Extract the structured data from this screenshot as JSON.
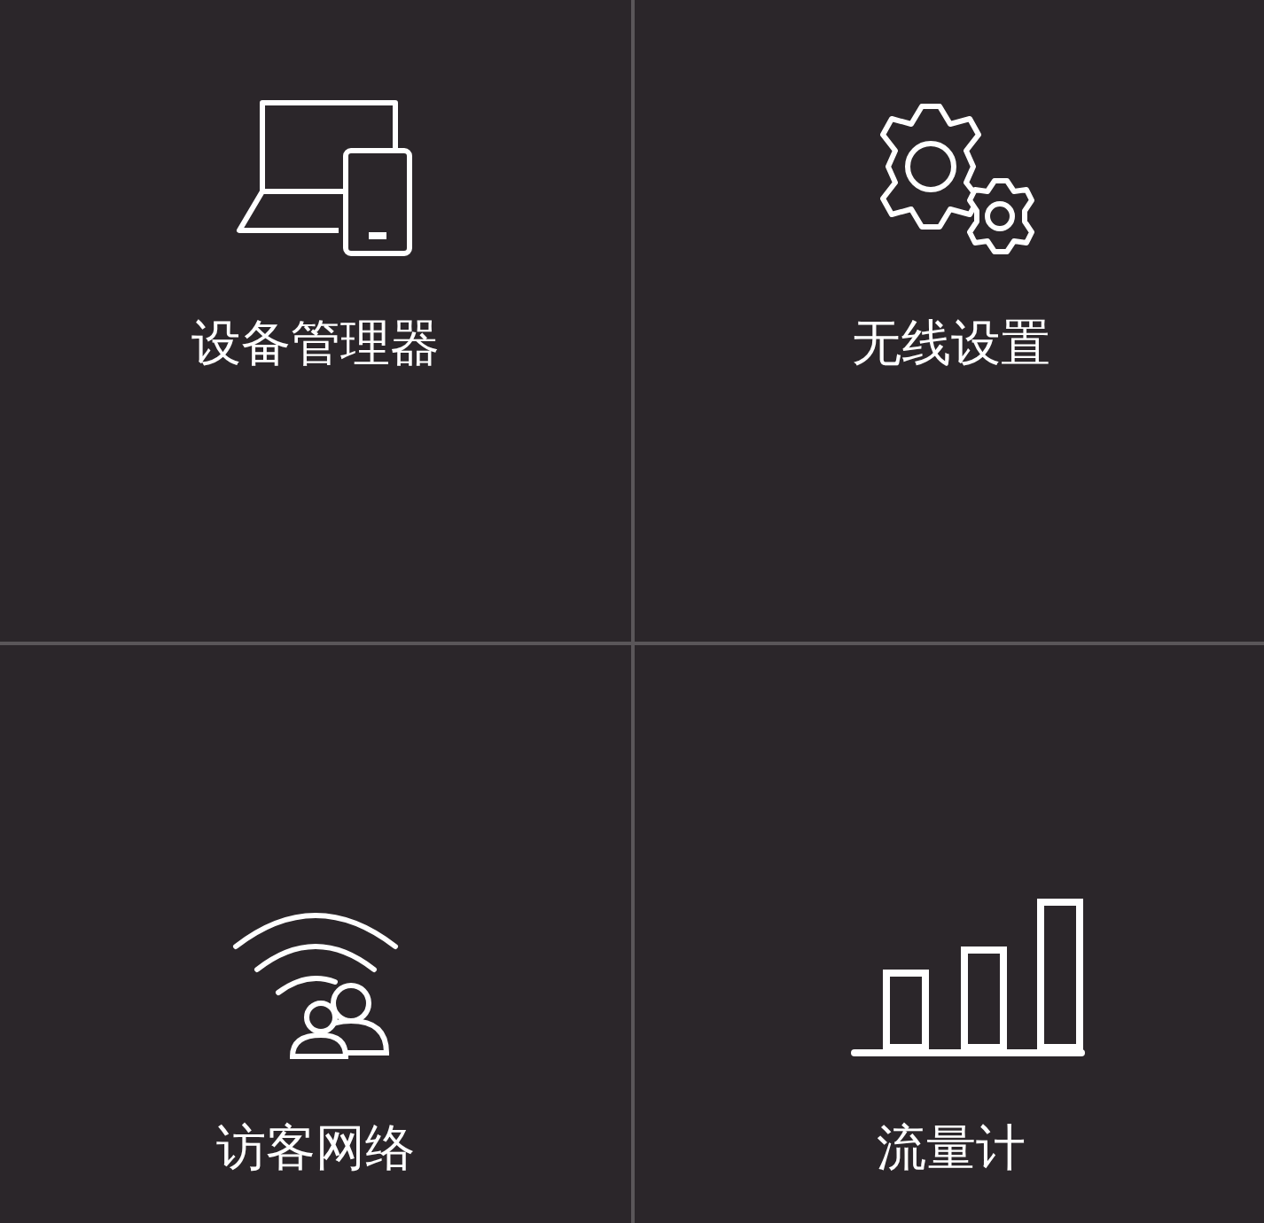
{
  "tiles": [
    {
      "kind": "devices",
      "label": "设备管理器"
    },
    {
      "kind": "gears",
      "label": "无线设置"
    },
    {
      "kind": "guest",
      "label": "访客网络"
    },
    {
      "kind": "traffic",
      "label": "流量计"
    }
  ]
}
